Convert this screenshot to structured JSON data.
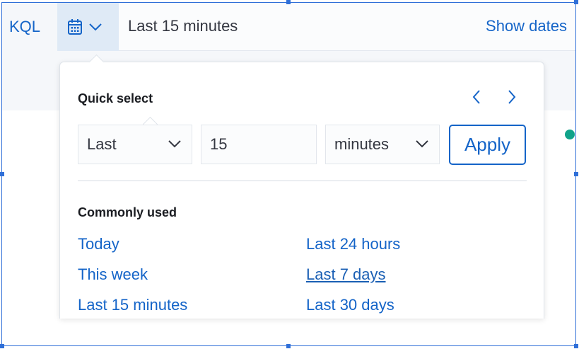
{
  "toolbar": {
    "query_language": "KQL",
    "calendar_icon": "calendar-icon",
    "dropdown_icon": "chevron-down-icon",
    "range_label": "Last 15 minutes",
    "show_dates": "Show dates"
  },
  "quick_select": {
    "title": "Quick select",
    "prev_icon": "chevron-left-icon",
    "next_icon": "chevron-right-icon",
    "direction_value": "Last",
    "amount_value": "15",
    "unit_value": "minutes",
    "apply_label": "Apply"
  },
  "commonly_used": {
    "title": "Commonly used",
    "items": [
      "Today",
      "This week",
      "Last 15 minutes",
      "Last 24 hours",
      "Last 7 days",
      "Last 30 days"
    ]
  },
  "colors": {
    "accent": "#1464c8",
    "status_dot": "#10a38a",
    "selection_frame": "#2f6fd8"
  }
}
